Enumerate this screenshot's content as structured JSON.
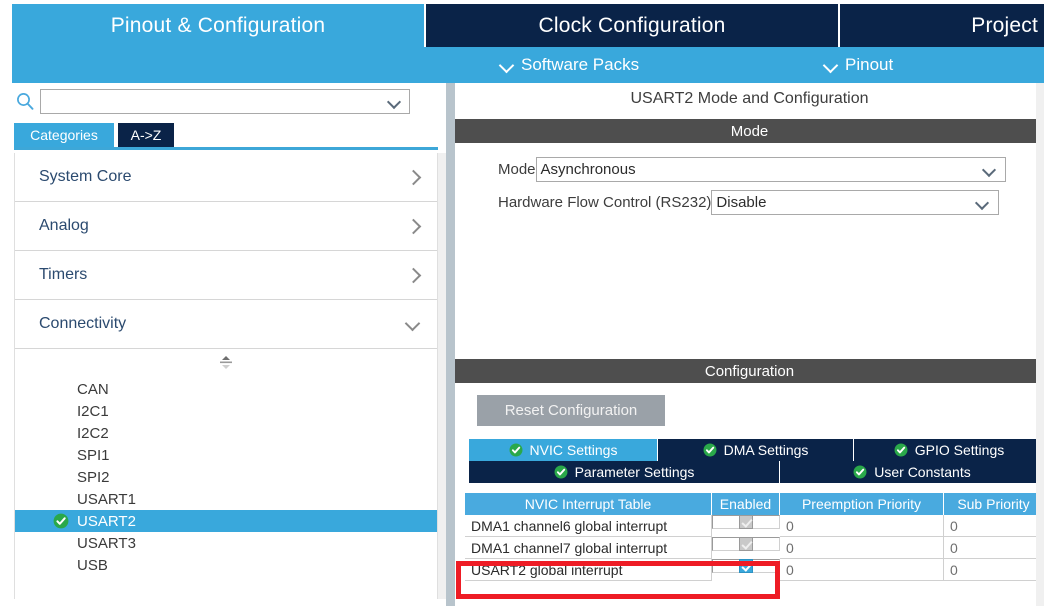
{
  "app": {
    "main_tabs": [
      {
        "label": "Pinout & Configuration",
        "active": true
      },
      {
        "label": "Clock Configuration",
        "active": false
      },
      {
        "label": "Project",
        "active": false
      }
    ],
    "sub_toolbar": [
      {
        "label": "Software Packs",
        "icon": "chevron-down-icon"
      },
      {
        "label": "Pinout",
        "icon": "chevron-down-icon"
      }
    ]
  },
  "left_panel": {
    "search": {
      "placeholder": "",
      "value": "",
      "icon": "search-icon"
    },
    "settings_icon": "gear-icon",
    "view_tabs": [
      {
        "label": "Categories",
        "active": true
      },
      {
        "label": "A->Z",
        "active": false
      }
    ],
    "categories": [
      {
        "label": "System Core",
        "expanded": false,
        "arrow": "chevron-right-icon"
      },
      {
        "label": "Analog",
        "expanded": false,
        "arrow": "chevron-right-icon"
      },
      {
        "label": "Timers",
        "expanded": false,
        "arrow": "chevron-right-icon"
      },
      {
        "label": "Connectivity",
        "expanded": true,
        "arrow": "chevron-down-icon"
      }
    ],
    "peripherals": [
      {
        "label": "CAN",
        "selected": false,
        "configured": false
      },
      {
        "label": "I2C1",
        "selected": false,
        "configured": false
      },
      {
        "label": "I2C2",
        "selected": false,
        "configured": false
      },
      {
        "label": "SPI1",
        "selected": false,
        "configured": false
      },
      {
        "label": "SPI2",
        "selected": false,
        "configured": false
      },
      {
        "label": "USART1",
        "selected": false,
        "configured": false
      },
      {
        "label": "USART2",
        "selected": true,
        "configured": true
      },
      {
        "label": "USART3",
        "selected": false,
        "configured": false
      },
      {
        "label": "USB",
        "selected": false,
        "configured": false
      }
    ]
  },
  "right_panel": {
    "title": "USART2 Mode and Configuration",
    "mode_band": "Mode",
    "mode_form": {
      "mode_label": "Mode",
      "mode_value": "Asynchronous",
      "hfc_label": "Hardware Flow Control (RS232)",
      "hfc_value": "Disable"
    },
    "configuration_band": "Configuration",
    "reset_button": "Reset Configuration",
    "config_tabs_row1": [
      {
        "label": "NVIC Settings",
        "active": true,
        "icon": "check-circle-icon"
      },
      {
        "label": "DMA Settings",
        "active": false,
        "icon": "check-circle-icon"
      },
      {
        "label": "GPIO Settings",
        "active": false,
        "icon": "check-circle-icon"
      }
    ],
    "config_tabs_row2": [
      {
        "label": "Parameter Settings",
        "active": false,
        "icon": "check-circle-icon"
      },
      {
        "label": "User Constants",
        "active": false,
        "icon": "check-circle-icon"
      }
    ],
    "nvic_table": {
      "columns": [
        "NVIC Interrupt Table",
        "Enabled",
        "Preemption Priority",
        "Sub Priority"
      ],
      "rows": [
        {
          "name": "DMA1 channel6 global interrupt",
          "enabled": true,
          "enabled_locked": true,
          "preemption": "0",
          "sub": "0"
        },
        {
          "name": "DMA1 channel7 global interrupt",
          "enabled": true,
          "enabled_locked": true,
          "preemption": "0",
          "sub": "0"
        },
        {
          "name": "USART2 global interrupt",
          "enabled": true,
          "enabled_locked": false,
          "preemption": "0",
          "sub": "0"
        }
      ]
    }
  },
  "annotation": {
    "highlight_row": "USART2 global interrupt",
    "color": "#ee1c25"
  },
  "colors": {
    "accent_blue": "#39a8dc",
    "dark_navy": "#0a2348",
    "band_gray": "#4e4e4e",
    "splitter": "#b8c4cc",
    "button_gray": "#9aa1a8",
    "table_header": "#49aadf",
    "highlight_red": "#ee1c25"
  }
}
